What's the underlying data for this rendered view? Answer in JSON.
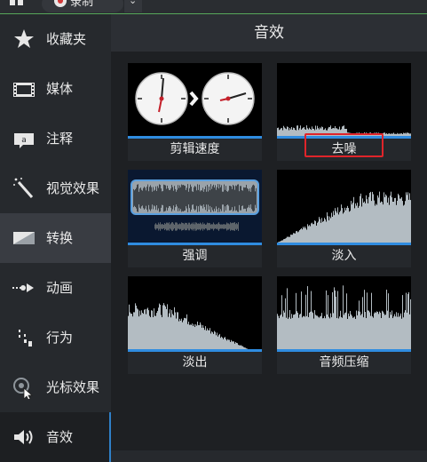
{
  "toolbar": {
    "record_label": "录制"
  },
  "sidebar": {
    "items": [
      {
        "label": "收藏夹",
        "icon": "star-icon"
      },
      {
        "label": "媒体",
        "icon": "film-icon"
      },
      {
        "label": "注释",
        "icon": "annotation-icon"
      },
      {
        "label": "视觉效果",
        "icon": "magic-wand-icon"
      },
      {
        "label": "转换",
        "icon": "transition-icon"
      },
      {
        "label": "动画",
        "icon": "animation-arrow-icon"
      },
      {
        "label": "行为",
        "icon": "behavior-icon"
      },
      {
        "label": "光标效果",
        "icon": "cursor-effect-icon"
      },
      {
        "label": "音效",
        "icon": "speaker-icon"
      }
    ]
  },
  "panel": {
    "title": "音效",
    "tiles": [
      {
        "label": "剪辑速度",
        "thumb": "clocks"
      },
      {
        "label": "去噪",
        "thumb": "noise-removal"
      },
      {
        "label": "强调",
        "thumb": "emphasize"
      },
      {
        "label": "淡入",
        "thumb": "fade-in"
      },
      {
        "label": "淡出",
        "thumb": "fade-out"
      },
      {
        "label": "音频压缩",
        "thumb": "compression"
      }
    ]
  },
  "colors": {
    "accent": "#2f8ce0",
    "highlight_box": "#e0242a",
    "waveform": "#b3bcc2"
  }
}
